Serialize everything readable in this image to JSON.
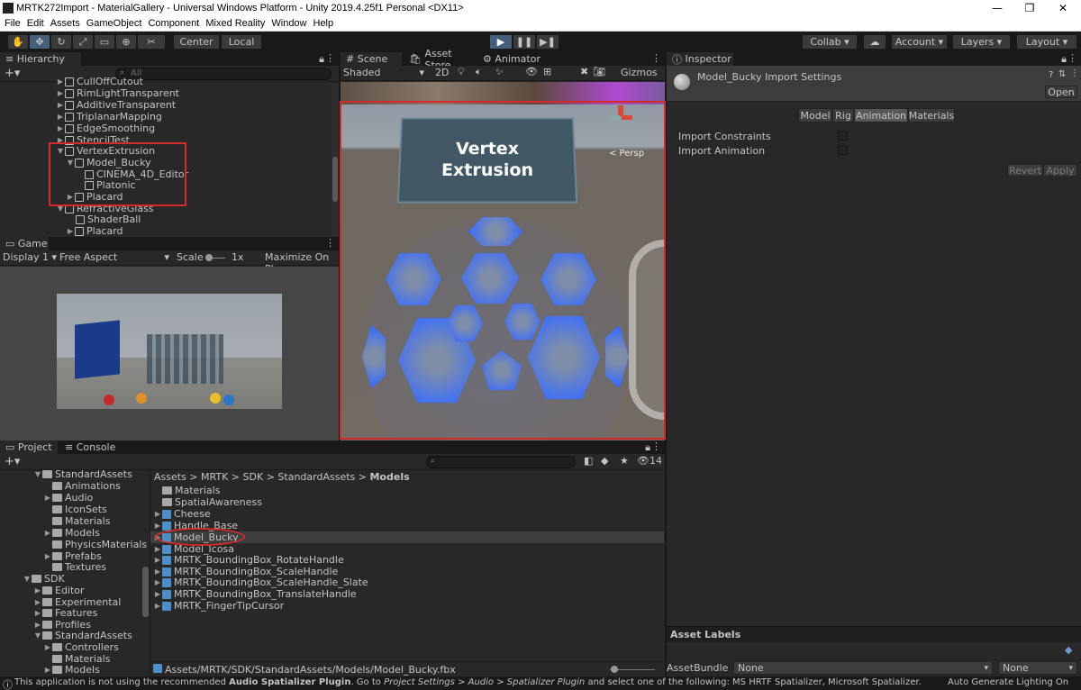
{
  "window": {
    "title": "MRTK272Import - MaterialGallery - Universal Windows Platform - Unity 2019.4.25f1 Personal <DX11>",
    "minimize": "—",
    "restore": "❐",
    "close": "✕"
  },
  "menu": [
    "File",
    "Edit",
    "Assets",
    "GameObject",
    "Component",
    "Mixed Reality",
    "Window",
    "Help"
  ],
  "toolbar": {
    "pivot": "Center",
    "space": "Local",
    "collab": "Collab",
    "account": "Account",
    "layers": "Layers",
    "layout": "Layout"
  },
  "hierarchy": {
    "tab": "Hierarchy",
    "search_placeholder": "All",
    "items": [
      {
        "label": "CullOffCutout"
      },
      {
        "label": "RimLightTransparent"
      },
      {
        "label": "AdditiveTransparent"
      },
      {
        "label": "TriplanarMapping"
      },
      {
        "label": "EdgeSmoothing"
      },
      {
        "label": "StencilTest"
      },
      {
        "label": "VertexExtrusion"
      },
      {
        "label": "Model_Bucky"
      },
      {
        "label": "CINEMA_4D_Editor"
      },
      {
        "label": "Platonic"
      },
      {
        "label": "Placard"
      },
      {
        "label": "RefractiveGlass"
      },
      {
        "label": "ShaderBall"
      },
      {
        "label": "Placard"
      }
    ]
  },
  "game": {
    "tab": "Game",
    "display": "Display 1",
    "aspect": "Free Aspect",
    "scale_label": "Scale",
    "scale_value": "1x",
    "maximize": "Maximize On Play"
  },
  "scene": {
    "tabs": [
      "Scene",
      "Asset Store",
      "Animator"
    ],
    "shading": "Shaded",
    "mode2d": "2D",
    "gizmos": "Gizmos",
    "persp": "< Persp",
    "placard_line1": "Vertex",
    "placard_line2": "Extrusion"
  },
  "inspector": {
    "tab": "Inspector",
    "title": "Model_Bucky Import Settings",
    "open": "Open",
    "tabs": [
      "Model",
      "Rig",
      "Animation",
      "Materials"
    ],
    "fields": [
      "Import Constraints",
      "Import Animation"
    ],
    "revert": "Revert",
    "apply": "Apply",
    "asset_labels": "Asset Labels",
    "asset_bundle_label": "AssetBundle",
    "asset_bundle_value": "None",
    "asset_bundle_variant": "None"
  },
  "project": {
    "tabs": [
      "Project",
      "Console"
    ],
    "count": "14",
    "tree": [
      {
        "label": "StandardAssets"
      },
      {
        "label": "Animations"
      },
      {
        "label": "Audio"
      },
      {
        "label": "IconSets"
      },
      {
        "label": "Materials"
      },
      {
        "label": "Models"
      },
      {
        "label": "PhysicsMaterials"
      },
      {
        "label": "Prefabs"
      },
      {
        "label": "Textures"
      },
      {
        "label": "SDK"
      },
      {
        "label": "Editor"
      },
      {
        "label": "Experimental"
      },
      {
        "label": "Features"
      },
      {
        "label": "Profiles"
      },
      {
        "label": "StandardAssets"
      },
      {
        "label": "Controllers"
      },
      {
        "label": "Materials"
      },
      {
        "label": "Models"
      }
    ],
    "breadcrumb": [
      "Assets",
      "MRTK",
      "SDK",
      "StandardAssets",
      "Models"
    ],
    "files": [
      {
        "label": "Materials"
      },
      {
        "label": "SpatialAwareness"
      },
      {
        "label": "Cheese"
      },
      {
        "label": "Handle_Base"
      },
      {
        "label": "Model_Bucky"
      },
      {
        "label": "Model_Icosa"
      },
      {
        "label": "MRTK_BoundingBox_RotateHandle"
      },
      {
        "label": "MRTK_BoundingBox_ScaleHandle"
      },
      {
        "label": "MRTK_BoundingBox_ScaleHandle_Slate"
      },
      {
        "label": "MRTK_BoundingBox_TranslateHandle"
      },
      {
        "label": "MRTK_FingerTipCursor"
      }
    ],
    "path": "Assets/MRTK/SDK/StandardAssets/Models/Model_Bucky.fbx"
  },
  "status": {
    "prefix": "This application is not using the recommended ",
    "plugin": "Audio Spatializer Plugin",
    "mid": ". Go to ",
    "settings": "Project Settings > Audio > Spatializer Plugin",
    "suffix": " and select one of the following: MS HRTF Spatializer, Microsoft Spatializer.",
    "right": "Auto Generate Lighting On"
  }
}
